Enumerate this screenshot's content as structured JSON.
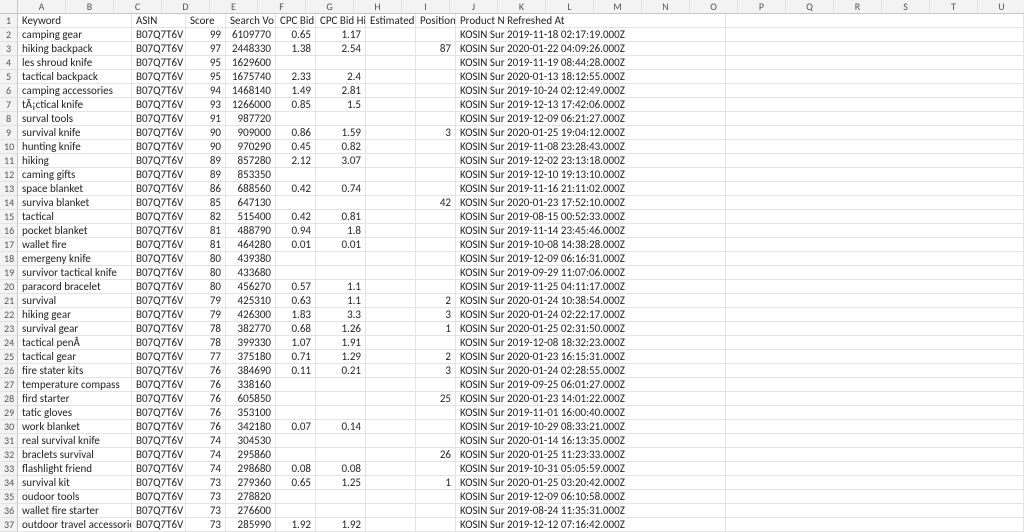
{
  "column_letters": [
    "A",
    "B",
    "C",
    "D",
    "E",
    "F",
    "G",
    "H",
    "I",
    "J",
    "K",
    "L",
    "M",
    "N",
    "O",
    "P",
    "Q",
    "R",
    "S",
    "T",
    "U"
  ],
  "headers": [
    "Keyword",
    "ASIN",
    "Score",
    "Search Vo",
    "CPC Bid Lo",
    "CPC Bid Hi",
    "Estimated",
    "Position",
    "Product N",
    "Refreshed At"
  ],
  "rows": [
    {
      "n": 2,
      "kw": "camping gear",
      "asin": "B07Q7T6V",
      "score": 99,
      "vol": 6109770,
      "lo": 0.65,
      "hi": 1.17,
      "est": "",
      "pos": "",
      "prod": "KOSIN Sur",
      "ref": "2019-11-18 02:17:19.000Z"
    },
    {
      "n": 3,
      "kw": "hiking backpack",
      "asin": "B07Q7T6V",
      "score": 97,
      "vol": 2448330,
      "lo": 1.38,
      "hi": 2.54,
      "est": "",
      "pos": 87,
      "prod": "KOSIN Sur",
      "ref": "2020-01-22 04:09:26.000Z"
    },
    {
      "n": 4,
      "kw": "les shroud knife",
      "asin": "B07Q7T6V",
      "score": 95,
      "vol": 1629600,
      "lo": "",
      "hi": "",
      "est": "",
      "pos": "",
      "prod": "KOSIN Sur",
      "ref": "2019-11-19 08:44:28.000Z"
    },
    {
      "n": 5,
      "kw": "tactical backpack",
      "asin": "B07Q7T6V",
      "score": 95,
      "vol": 1675740,
      "lo": 2.33,
      "hi": 2.4,
      "est": "",
      "pos": "",
      "prod": "KOSIN Sur",
      "ref": "2020-01-13 18:12:55.000Z"
    },
    {
      "n": 6,
      "kw": "camping accessories",
      "asin": "B07Q7T6V",
      "score": 94,
      "vol": 1468140,
      "lo": 1.49,
      "hi": 2.81,
      "est": "",
      "pos": "",
      "prod": "KOSIN Sur",
      "ref": "2019-10-24 02:12:49.000Z"
    },
    {
      "n": 7,
      "kw": "tÃ¡ctical knife",
      "asin": "B07Q7T6V",
      "score": 93,
      "vol": 1266000,
      "lo": 0.85,
      "hi": 1.5,
      "est": "",
      "pos": "",
      "prod": "KOSIN Sur",
      "ref": "2019-12-13 17:42:06.000Z"
    },
    {
      "n": 8,
      "kw": "surval tools",
      "asin": "B07Q7T6V",
      "score": 91,
      "vol": 987720,
      "lo": "",
      "hi": "",
      "est": "",
      "pos": "",
      "prod": "KOSIN Sur",
      "ref": "2019-12-09 06:21:27.000Z"
    },
    {
      "n": 9,
      "kw": "survival knife",
      "asin": "B07Q7T6V",
      "score": 90,
      "vol": 909000,
      "lo": 0.86,
      "hi": 1.59,
      "est": "",
      "pos": 3,
      "prod": "KOSIN Sur",
      "ref": "2020-01-25 19:04:12.000Z"
    },
    {
      "n": 10,
      "kw": "hunting knife",
      "asin": "B07Q7T6V",
      "score": 90,
      "vol": 970290,
      "lo": 0.45,
      "hi": 0.82,
      "est": "",
      "pos": "",
      "prod": "KOSIN Sur",
      "ref": "2019-11-08 23:28:43.000Z"
    },
    {
      "n": 11,
      "kw": "hiking",
      "asin": "B07Q7T6V",
      "score": 89,
      "vol": 857280,
      "lo": 2.12,
      "hi": 3.07,
      "est": "",
      "pos": "",
      "prod": "KOSIN Sur",
      "ref": "2019-12-02 23:13:18.000Z"
    },
    {
      "n": 12,
      "kw": "caming gifts",
      "asin": "B07Q7T6V",
      "score": 89,
      "vol": 853350,
      "lo": "",
      "hi": "",
      "est": "",
      "pos": "",
      "prod": "KOSIN Sur",
      "ref": "2019-12-10 19:13:10.000Z"
    },
    {
      "n": 13,
      "kw": "space blanket",
      "asin": "B07Q7T6V",
      "score": 86,
      "vol": 688560,
      "lo": 0.42,
      "hi": 0.74,
      "est": "",
      "pos": "",
      "prod": "KOSIN Sur",
      "ref": "2019-11-16 21:11:02.000Z"
    },
    {
      "n": 14,
      "kw": "surviva blanket",
      "asin": "B07Q7T6V",
      "score": 85,
      "vol": 647130,
      "lo": "",
      "hi": "",
      "est": "",
      "pos": 42,
      "prod": "KOSIN Sur",
      "ref": "2020-01-23 17:52:10.000Z"
    },
    {
      "n": 15,
      "kw": "tactical",
      "asin": "B07Q7T6V",
      "score": 82,
      "vol": 515400,
      "lo": 0.42,
      "hi": 0.81,
      "est": "",
      "pos": "",
      "prod": "KOSIN Sur",
      "ref": "2019-08-15 00:52:33.000Z"
    },
    {
      "n": 16,
      "kw": "pocket blanket",
      "asin": "B07Q7T6V",
      "score": 81,
      "vol": 488790,
      "lo": 0.94,
      "hi": 1.8,
      "est": "",
      "pos": "",
      "prod": "KOSIN Sur",
      "ref": "2019-11-14 23:45:46.000Z"
    },
    {
      "n": 17,
      "kw": "wallet fire",
      "asin": "B07Q7T6V",
      "score": 81,
      "vol": 464280,
      "lo": 0.01,
      "hi": 0.01,
      "est": "",
      "pos": "",
      "prod": "KOSIN Sur",
      "ref": "2019-10-08 14:38:28.000Z"
    },
    {
      "n": 18,
      "kw": "emergeny knife",
      "asin": "B07Q7T6V",
      "score": 80,
      "vol": 439380,
      "lo": "",
      "hi": "",
      "est": "",
      "pos": "",
      "prod": "KOSIN Sur",
      "ref": "2019-12-09 06:16:31.000Z"
    },
    {
      "n": 19,
      "kw": "survivor tactical knife",
      "asin": "B07Q7T6V",
      "score": 80,
      "vol": 433680,
      "lo": "",
      "hi": "",
      "est": "",
      "pos": "",
      "prod": "KOSIN Sur",
      "ref": "2019-09-29 11:07:06.000Z"
    },
    {
      "n": 20,
      "kw": "paracord bracelet",
      "asin": "B07Q7T6V",
      "score": 80,
      "vol": 456270,
      "lo": 0.57,
      "hi": 1.1,
      "est": "",
      "pos": "",
      "prod": "KOSIN Sur",
      "ref": "2019-11-25 04:11:17.000Z"
    },
    {
      "n": 21,
      "kw": "survival",
      "asin": "B07Q7T6V",
      "score": 79,
      "vol": 425310,
      "lo": 0.63,
      "hi": 1.1,
      "est": "",
      "pos": 2,
      "prod": "KOSIN Sur",
      "ref": "2020-01-24 10:38:54.000Z"
    },
    {
      "n": 22,
      "kw": "hiking gear",
      "asin": "B07Q7T6V",
      "score": 79,
      "vol": 426300,
      "lo": 1.83,
      "hi": 3.3,
      "est": "",
      "pos": 3,
      "prod": "KOSIN Sur",
      "ref": "2020-01-24 02:22:17.000Z"
    },
    {
      "n": 23,
      "kw": "survival gear",
      "asin": "B07Q7T6V",
      "score": 78,
      "vol": 382770,
      "lo": 0.68,
      "hi": 1.26,
      "est": "",
      "pos": 1,
      "prod": "KOSIN Sur",
      "ref": "2020-01-25 02:31:50.000Z"
    },
    {
      "n": 24,
      "kw": "tactical penÂ",
      "asin": "B07Q7T6V",
      "score": 78,
      "vol": 399330,
      "lo": 1.07,
      "hi": 1.91,
      "est": "",
      "pos": "",
      "prod": "KOSIN Sur",
      "ref": "2019-12-08 18:32:23.000Z"
    },
    {
      "n": 25,
      "kw": "tactical gear",
      "asin": "B07Q7T6V",
      "score": 77,
      "vol": 375180,
      "lo": 0.71,
      "hi": 1.29,
      "est": "",
      "pos": 2,
      "prod": "KOSIN Sur",
      "ref": "2020-01-23 16:15:31.000Z"
    },
    {
      "n": 26,
      "kw": "fire stater kits",
      "asin": "B07Q7T6V",
      "score": 76,
      "vol": 384690,
      "lo": 0.11,
      "hi": 0.21,
      "est": "",
      "pos": 3,
      "prod": "KOSIN Sur",
      "ref": "2020-01-24 02:28:55.000Z"
    },
    {
      "n": 27,
      "kw": "temperature compass",
      "asin": "B07Q7T6V",
      "score": 76,
      "vol": 338160,
      "lo": "",
      "hi": "",
      "est": "",
      "pos": "",
      "prod": "KOSIN Sur",
      "ref": "2019-09-25 06:01:27.000Z"
    },
    {
      "n": 28,
      "kw": "fird starter",
      "asin": "B07Q7T6V",
      "score": 76,
      "vol": 605850,
      "lo": "",
      "hi": "",
      "est": "",
      "pos": 25,
      "prod": "KOSIN Sur",
      "ref": "2020-01-23 14:01:22.000Z"
    },
    {
      "n": 29,
      "kw": "tatic gloves",
      "asin": "B07Q7T6V",
      "score": 76,
      "vol": 353100,
      "lo": "",
      "hi": "",
      "est": "",
      "pos": "",
      "prod": "KOSIN Sur",
      "ref": "2019-11-01 16:00:40.000Z"
    },
    {
      "n": 30,
      "kw": "work blanket",
      "asin": "B07Q7T6V",
      "score": 76,
      "vol": 342180,
      "lo": 0.07,
      "hi": 0.14,
      "est": "",
      "pos": "",
      "prod": "KOSIN Sur",
      "ref": "2019-10-29 08:33:21.000Z"
    },
    {
      "n": 31,
      "kw": "real survival knife",
      "asin": "B07Q7T6V",
      "score": 74,
      "vol": 304530,
      "lo": "",
      "hi": "",
      "est": "",
      "pos": "",
      "prod": "KOSIN Sur",
      "ref": "2020-01-14 16:13:35.000Z"
    },
    {
      "n": 32,
      "kw": "braclets survival",
      "asin": "B07Q7T6V",
      "score": 74,
      "vol": 295860,
      "lo": "",
      "hi": "",
      "est": "",
      "pos": 26,
      "prod": "KOSIN Sur",
      "ref": "2020-01-25 11:23:33.000Z"
    },
    {
      "n": 33,
      "kw": "flashlight friend",
      "asin": "B07Q7T6V",
      "score": 74,
      "vol": 298680,
      "lo": 0.08,
      "hi": 0.08,
      "est": "",
      "pos": "",
      "prod": "KOSIN Sur",
      "ref": "2019-10-31 05:05:59.000Z"
    },
    {
      "n": 34,
      "kw": "survival kit",
      "asin": "B07Q7T6V",
      "score": 73,
      "vol": 279360,
      "lo": 0.65,
      "hi": 1.25,
      "est": "",
      "pos": 1,
      "prod": "KOSIN Sur",
      "ref": "2020-01-25 03:20:42.000Z"
    },
    {
      "n": 35,
      "kw": "oudoor tools",
      "asin": "B07Q7T6V",
      "score": 73,
      "vol": 278820,
      "lo": "",
      "hi": "",
      "est": "",
      "pos": "",
      "prod": "KOSIN Sur",
      "ref": "2019-12-09 06:10:58.000Z"
    },
    {
      "n": 36,
      "kw": "wallet fire starter",
      "asin": "B07Q7T6V",
      "score": 73,
      "vol": 276600,
      "lo": "",
      "hi": "",
      "est": "",
      "pos": "",
      "prod": "KOSIN Sur",
      "ref": "2019-08-24 11:35:31.000Z"
    },
    {
      "n": 37,
      "kw": "outdoor travel accessories",
      "asin": "B07Q7T6V",
      "score": 73,
      "vol": 285990,
      "lo": 1.92,
      "hi": 1.92,
      "est": "",
      "pos": "",
      "prod": "KOSIN Sur",
      "ref": "2019-12-12 07:16:42.000Z"
    }
  ]
}
